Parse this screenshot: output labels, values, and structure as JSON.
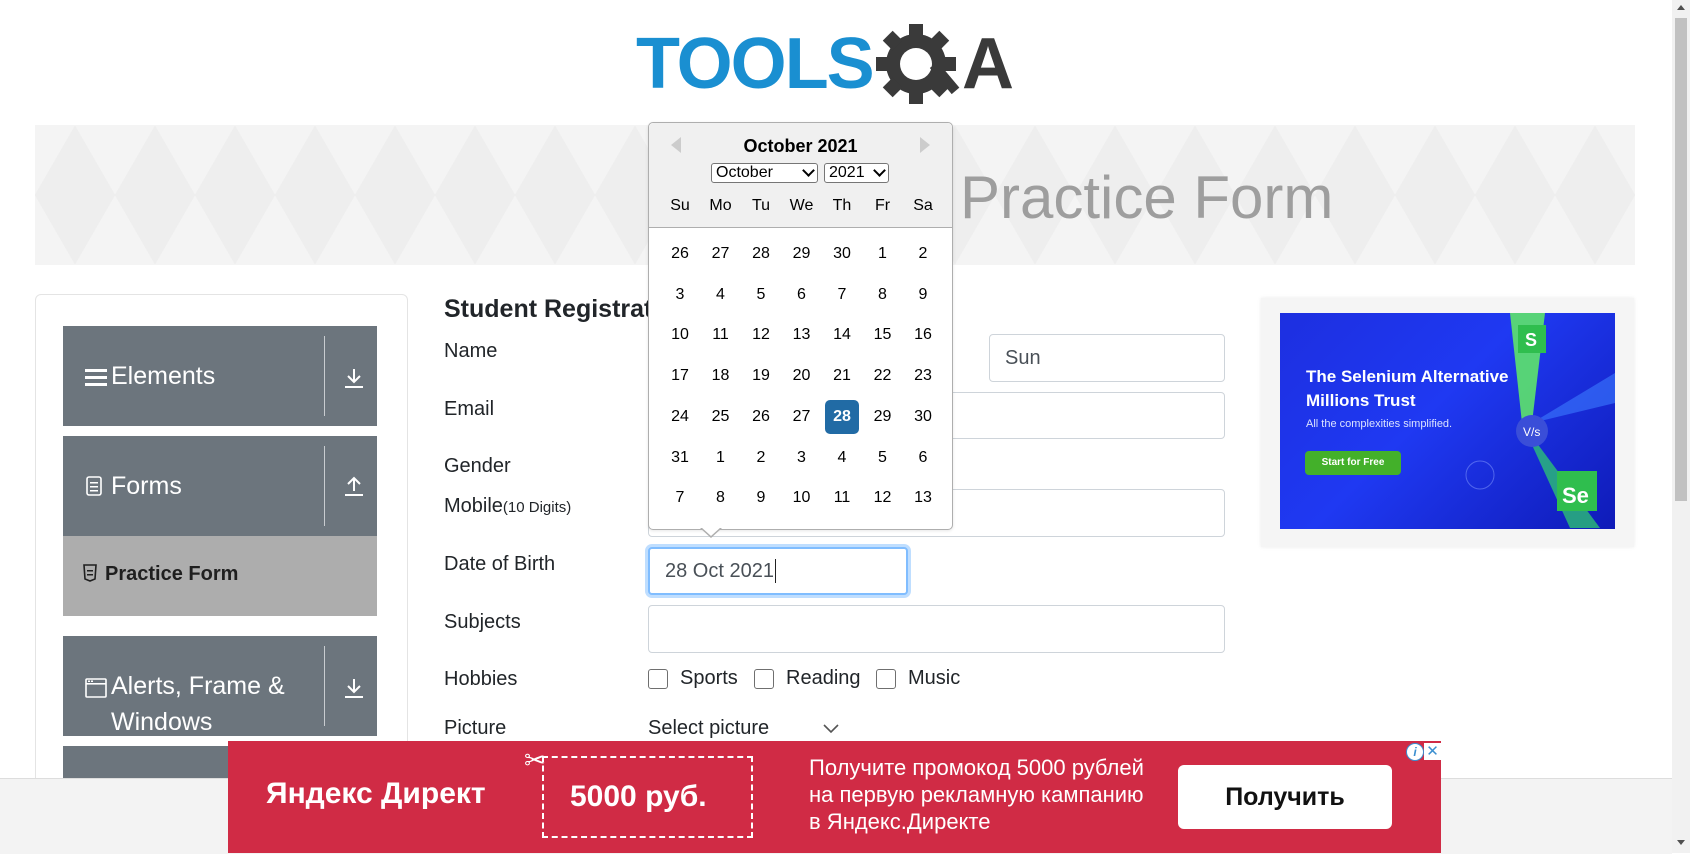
{
  "logo": {
    "text_left": "TOOLS",
    "text_right": "A"
  },
  "banner": {
    "title": "Practice Form"
  },
  "sidebar": {
    "groups": [
      {
        "label": "Elements",
        "icon": "hamburger-icon",
        "arrow": "download-icon"
      },
      {
        "label": "Forms",
        "icon": "document-icon",
        "arrow": "upload-icon"
      },
      {
        "label": "Alerts, Frame &",
        "label2": "Windows",
        "icon": "window-icon",
        "arrow": "download-icon"
      }
    ],
    "active_item": "Practice Form"
  },
  "form": {
    "title": "Student Registration Form",
    "labels": {
      "name": "Name",
      "email": "Email",
      "gender": "Gender",
      "mobile": "Mobile",
      "mobile_hint": "(10 Digits)",
      "dob": "Date of Birth",
      "subjects": "Subjects",
      "hobbies": "Hobbies",
      "picture": "Picture"
    },
    "last_name_value": "Sun",
    "dob_value": "28 Oct 2021",
    "hobbies": [
      "Sports",
      "Reading",
      "Music"
    ],
    "picture_button": "Select picture"
  },
  "datepicker": {
    "title": "October 2021",
    "month_select": "October",
    "year_select": "2021",
    "day_names": [
      "Su",
      "Mo",
      "Tu",
      "We",
      "Th",
      "Fr",
      "Sa"
    ],
    "weeks": [
      [
        "26",
        "27",
        "28",
        "29",
        "30",
        "1",
        "2"
      ],
      [
        "3",
        "4",
        "5",
        "6",
        "7",
        "8",
        "9"
      ],
      [
        "10",
        "11",
        "12",
        "13",
        "14",
        "15",
        "16"
      ],
      [
        "17",
        "18",
        "19",
        "20",
        "21",
        "22",
        "23"
      ],
      [
        "24",
        "25",
        "26",
        "27",
        "28",
        "29",
        "30"
      ],
      [
        "31",
        "1",
        "2",
        "3",
        "4",
        "5",
        "6"
      ],
      [
        "7",
        "8",
        "9",
        "10",
        "11",
        "12",
        "13"
      ]
    ],
    "selected_day": "28",
    "selected_color": "#216ba5"
  },
  "side_ad": {
    "headline": "The Selenium Alternative Millions Trust",
    "subline": "All the complexities simplified.",
    "button": "Start for Free",
    "bg_color": "#1f39f2"
  },
  "bottom_ad": {
    "brand": "Яндекс Директ",
    "coupon": "5000 руб.",
    "description": "Получите промокод 5000 рублей на первую рекламную кампанию в Яндекс.Директе",
    "button": "Получить",
    "bg_color": "#d02b45"
  }
}
